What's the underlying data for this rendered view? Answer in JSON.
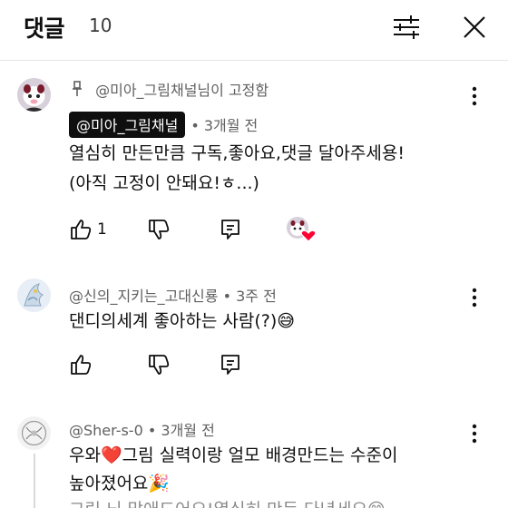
{
  "header": {
    "title": "댓글",
    "count": "10"
  },
  "comments": [
    {
      "pinned_text": "@미아_그림채널님이 고정함",
      "author": "@미아_그림채널",
      "time": "• 3개월 전",
      "lines": [
        "열심히 만든만큼 구독,좋아요,댓글 달아주세용!",
        "(아직 고정이 안돼요!ㅎ...)"
      ],
      "likes": "1",
      "creator_heart": true
    },
    {
      "author": "@신의_지키는_고대신룡",
      "time": "• 3주 전",
      "lines": [
        "댄디의세계 좋아하는 사람(?)😅"
      ],
      "likes": ""
    },
    {
      "author": "@Sher-s-0",
      "time": "• 3개월 전",
      "lines": [
        "우와❤️그림 실력이랑 얼모 배경만드는 수준이",
        "높아졌어요🎉",
        "그림 뇌 맞애드어요!열심히 만든 다년세요😊"
      ],
      "likes": ""
    }
  ],
  "icons": {
    "sort": "sliders-icon",
    "close": "close-icon",
    "pin": "pin-icon",
    "more": "more-vertical-icon",
    "like": "thumbs-up-icon",
    "dislike": "thumbs-down-icon",
    "reply": "reply-icon",
    "heart": "heart-icon"
  },
  "colors": {
    "heart": "#ff0033",
    "chip_bg": "#0f0f0f",
    "meta": "#606060"
  }
}
